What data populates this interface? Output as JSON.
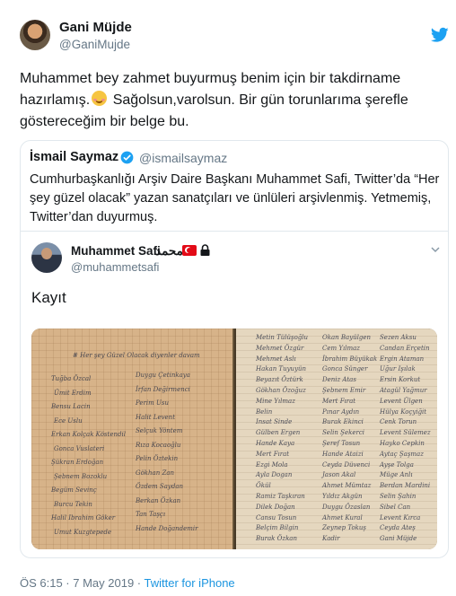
{
  "tweet": {
    "author_name": "Gani Müjde",
    "author_handle": "@GaniMujde",
    "text_part1": "Muhammet bey zahmet buyurmuş benim için bir takdirname hazırlamış.",
    "text_part2": " Sağolsun,varolsun. Bir gün torunlarıma şerefle göstereceğim bir belge bu.",
    "emoji": "smiling-face-emoji",
    "timestamp": "ÖS 6:15 · 7 May 2019 · ",
    "source": "Twitter for iPhone"
  },
  "quote": {
    "author_name": "İsmail Saymaz",
    "author_handle": "@ismailsaymaz",
    "text": "Cumhurbaşkanlığı Arşiv Daire Başkanı Muhammet Safi, Twitter’da “Her şey güzel olacak” yazan sanatçıları ve ünlüleri arşivlenmiş. Yetmemiş, Twitter’dan duyurmuş."
  },
  "embedded": {
    "author_name": "Muhammet Safi",
    "author_arabic": "محمد",
    "author_handle": "@muhammetsafi",
    "text": "Kayıt",
    "photo": {
      "left_header": "# Her şey Güzel Olacak diyenler davam",
      "left_names": [
        "Tuğba Özcal",
        "Ümit Erdim",
        "Bensu Lacin",
        "Ece Uslu",
        "Erkan Kolçak Köstendil",
        "Gonca Vuslateri",
        "Şükran Erdoğan",
        "Şebnem Bozoklu",
        "Begüm Sevinç",
        "Burcu Tekin",
        "Halil Ibrahim Göker",
        "Umut Kuzgtepede"
      ],
      "left_names_col2": [
        "Duygu Çetinkaya",
        "İrfan Değirmenci",
        "Perim Usu",
        "Halit Levent",
        "Selçuk Yöntem",
        "Rıza Kocaoğlu",
        "Pelin Öztekin",
        "Gökhan Zan",
        "Özdem Saydan",
        "Berkan Özkan",
        "Tan Taşçı",
        "Hande Doğandemir"
      ],
      "right_col1": [
        "Metin Tülüşoğlu",
        "Mehmet Özgür",
        "Mehmet Aslı",
        "Hakan Tuyuyün",
        "Beyazıt Öztürk",
        "Gökhan Özoğuz",
        "Mine Yılmaz",
        "Belin",
        "Insat Sinde",
        "Gülben Ergen",
        "Hande Kaya",
        "Mert Fırat",
        "Ezgi Mola",
        "Ayla Dogan",
        "Ökül",
        "Ramiz Taşkıran",
        "Dilek Doğan",
        "Cansu Tosun",
        "Belçim Bilgin",
        "Burak Özkan"
      ],
      "right_col2": [
        "Okan Bayülgen",
        "Cem Yılmaz",
        "İbrahim Büyükak",
        "Gonca Sünger",
        "Deniz Atas",
        "Şebnem Emir",
        "Mert Fırat",
        "Pınar Aydın",
        "Burak Ekinci",
        "Selin Şekerci",
        "Şeref Tosun",
        "Hande Ataizi",
        "Ceyda Düvenci",
        "Jason Akal",
        "Ahmet Mümtaz",
        "Yıldız Akgün",
        "Duygu Özaslan",
        "Ahmet Kural",
        "Zeynep Tokuş",
        "Kadir"
      ],
      "right_col3": [
        "Sezen Aksu",
        "Candan Erçetin",
        "Ergin Ataman",
        "Uğur Işılak",
        "Ersin Korkut",
        "Atagül Yağmur",
        "Levent Ülgen",
        "Hülya Koçyiğit",
        "Cenk Torun",
        "Levent Sülemez",
        "Hayko Cepkin",
        "Aytaç Şaşmaz",
        "Ayşe Tolga",
        "Müge Anlı",
        "Berdan Mardini",
        "Selin Şahin",
        "Sibel Can",
        "Levent Kırca",
        "Ceyda Ateş",
        "Gani Müjde"
      ]
    }
  },
  "icons": {
    "bird": "twitter-bird-icon",
    "verified": "verified-badge-icon",
    "flag": "turkey-flag-icon",
    "lock": "lock-icon",
    "chevron": "chevron-down-icon"
  },
  "colors": {
    "accent": "#1da1f2",
    "muted": "#657786",
    "border": "#e1e8ed"
  }
}
